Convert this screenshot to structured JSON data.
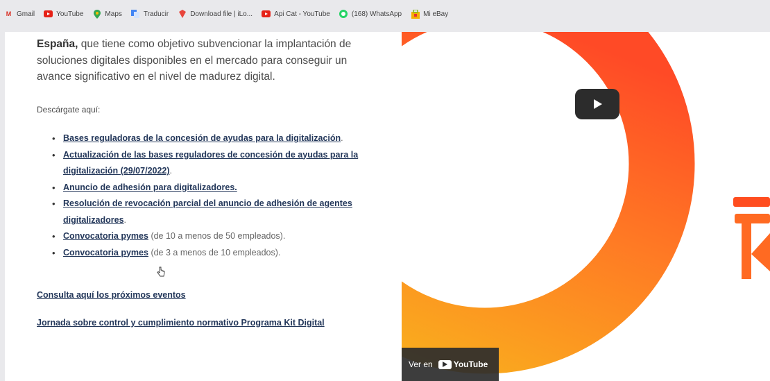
{
  "bookmarks": [
    {
      "label": "Gmail",
      "icon": "gmail-icon",
      "color": "#d93025"
    },
    {
      "label": "YouTube",
      "icon": "youtube-icon",
      "color": "#e62117"
    },
    {
      "label": "Maps",
      "icon": "maps-icon",
      "color": "#34a853"
    },
    {
      "label": "Traducir",
      "icon": "translate-icon",
      "color": "#4285f4"
    },
    {
      "label": "Download file | iLo...",
      "icon": "download-icon",
      "color": "#e8453c"
    },
    {
      "label": "Api Cat - YouTube",
      "icon": "youtube-icon",
      "color": "#e62117"
    },
    {
      "label": "(168) WhatsApp",
      "icon": "whatsapp-icon",
      "color": "#25d366"
    },
    {
      "label": "Mi eBay",
      "icon": "ebay-icon",
      "color": "#e53238"
    }
  ],
  "intro": {
    "bold": "España,",
    "text": " que tiene como objetivo subvencionar la implantación de soluciones digitales disponibles en el mercado para conseguir un avance significativo en el nivel de madurez digital."
  },
  "download_label": "Descárgate aquí:",
  "links": [
    {
      "text": "Bases reguladoras de la concesión de ayudas para la digitalización",
      "suffix": "."
    },
    {
      "text": "Actualización de las bases reguladores de concesión de ayudas para la digitalización (29/07/2022)",
      "suffix": "."
    },
    {
      "text": "Anuncio de adhesión para digitalizadores.",
      "suffix": ""
    },
    {
      "text": "Resolución de revocación parcial del anuncio de adhesión de agentes digitalizadores",
      "suffix": "."
    },
    {
      "text": "Convocatoria pymes",
      "suffix": " (de 10 a menos de 50 empleados)."
    },
    {
      "text": "Convocatoria pymes",
      "suffix": " (de 3 a menos de 10 empleados)."
    }
  ],
  "events": {
    "next_events": "Consulta aquí los próximos eventos",
    "jornada": "Jornada sobre control y cumplimiento normativo Programa Kit Digital"
  },
  "video": {
    "watch_on": "Ver en",
    "brand": "YouTube",
    "ring_colors": [
      "#ff5a2a",
      "#f7a21e"
    ],
    "logo_color": "#ff4d1f"
  }
}
